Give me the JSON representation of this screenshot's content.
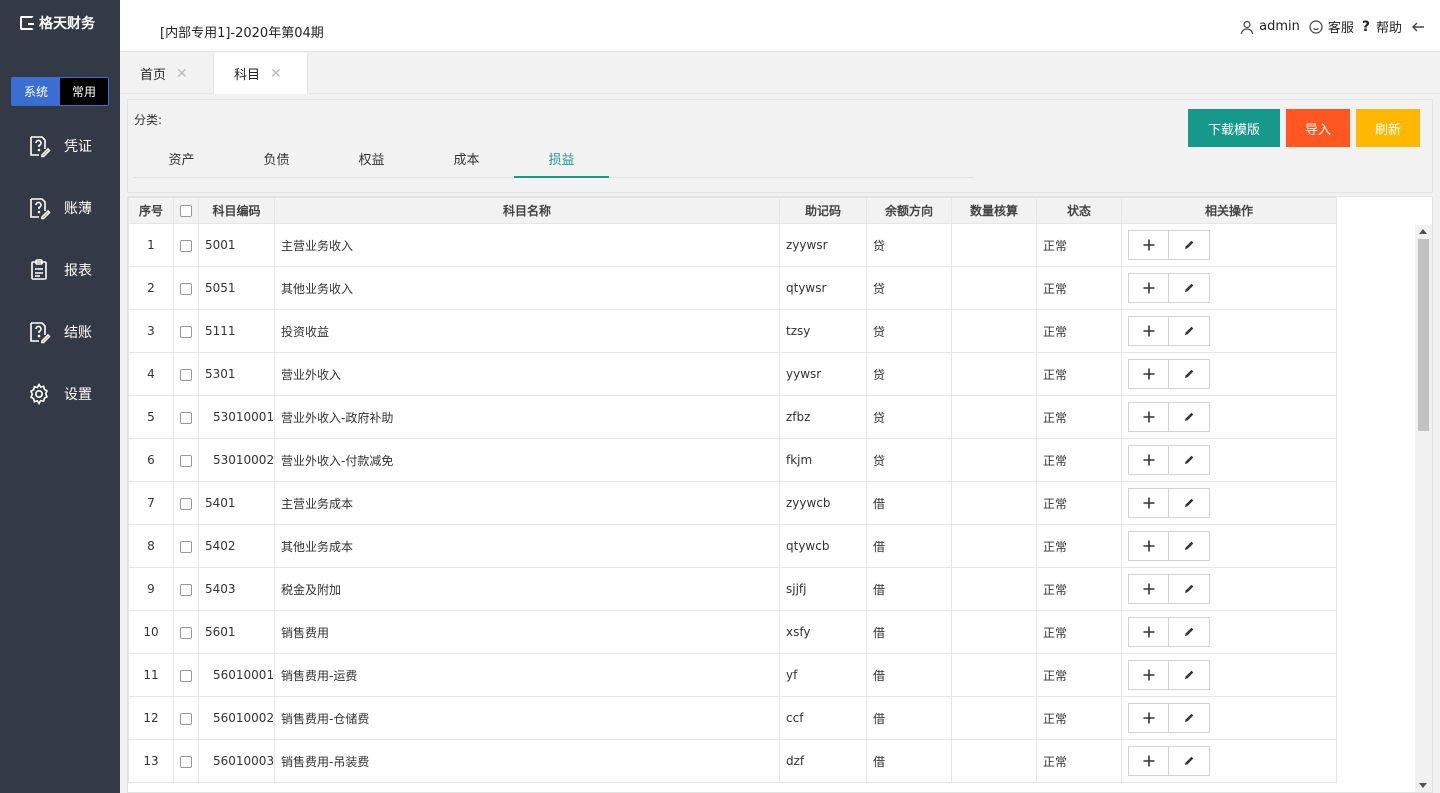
{
  "app": {
    "logo_text": "格天财务",
    "mode_switch": {
      "system": "系统",
      "common": "常用"
    }
  },
  "sidebar": {
    "items": [
      {
        "label": "凭证",
        "icon": "document-question-icon"
      },
      {
        "label": "账薄",
        "icon": "document-question-icon"
      },
      {
        "label": "报表",
        "icon": "clipboard-icon"
      },
      {
        "label": "结账",
        "icon": "document-question-icon"
      },
      {
        "label": "设置",
        "icon": "gear-icon"
      }
    ]
  },
  "header": {
    "period": "[内部专用1]-2020年第04期",
    "user": "admin",
    "service": "客服",
    "help": "帮助"
  },
  "page_tabs": [
    {
      "label": "首页"
    },
    {
      "label": "科目"
    }
  ],
  "filter": {
    "label": "分类:",
    "categories": [
      "资产",
      "负债",
      "权益",
      "成本",
      "损益"
    ],
    "active_category": "损益",
    "buttons": {
      "download": "下载模版",
      "import": "导入",
      "refresh": "刷新"
    }
  },
  "table": {
    "headers": [
      "序号",
      "",
      "科目编码",
      "科目名称",
      "助记码",
      "余额方向",
      "数量核算",
      "状态",
      "相关操作"
    ],
    "rows": [
      {
        "idx": "1",
        "code": "5001",
        "name": "主营业务收入",
        "mnemonic": "zyywsr",
        "direction": "贷",
        "qty": "",
        "status": "正常",
        "sub": false
      },
      {
        "idx": "2",
        "code": "5051",
        "name": "其他业务收入",
        "mnemonic": "qtywsr",
        "direction": "贷",
        "qty": "",
        "status": "正常",
        "sub": false
      },
      {
        "idx": "3",
        "code": "5111",
        "name": "投资收益",
        "mnemonic": "tzsy",
        "direction": "贷",
        "qty": "",
        "status": "正常",
        "sub": false
      },
      {
        "idx": "4",
        "code": "5301",
        "name": "营业外收入",
        "mnemonic": "yywsr",
        "direction": "贷",
        "qty": "",
        "status": "正常",
        "sub": false
      },
      {
        "idx": "5",
        "code": "53010001",
        "name": "营业外收入-政府补助",
        "mnemonic": "zfbz",
        "direction": "贷",
        "qty": "",
        "status": "正常",
        "sub": true
      },
      {
        "idx": "6",
        "code": "53010002",
        "name": "营业外收入-付款减免",
        "mnemonic": "fkjm",
        "direction": "贷",
        "qty": "",
        "status": "正常",
        "sub": true
      },
      {
        "idx": "7",
        "code": "5401",
        "name": "主营业务成本",
        "mnemonic": "zyywcb",
        "direction": "借",
        "qty": "",
        "status": "正常",
        "sub": false
      },
      {
        "idx": "8",
        "code": "5402",
        "name": "其他业务成本",
        "mnemonic": "qtywcb",
        "direction": "借",
        "qty": "",
        "status": "正常",
        "sub": false
      },
      {
        "idx": "9",
        "code": "5403",
        "name": "税金及附加",
        "mnemonic": "sjjfj",
        "direction": "借",
        "qty": "",
        "status": "正常",
        "sub": false
      },
      {
        "idx": "10",
        "code": "5601",
        "name": "销售费用",
        "mnemonic": "xsfy",
        "direction": "借",
        "qty": "",
        "status": "正常",
        "sub": false
      },
      {
        "idx": "11",
        "code": "56010001",
        "name": "销售费用-运费",
        "mnemonic": "yf",
        "direction": "借",
        "qty": "",
        "status": "正常",
        "sub": true
      },
      {
        "idx": "12",
        "code": "56010002",
        "name": "销售费用-仓储费",
        "mnemonic": "ccf",
        "direction": "借",
        "qty": "",
        "status": "正常",
        "sub": true
      },
      {
        "idx": "13",
        "code": "56010003",
        "name": "销售费用-吊装费",
        "mnemonic": "dzf",
        "direction": "借",
        "qty": "",
        "status": "正常",
        "sub": true
      }
    ]
  },
  "colors": {
    "sidebar_bg": "#343a45",
    "accent_green": "#16998a",
    "import_orange": "#ff5722",
    "refresh_yellow": "#ffb800",
    "switch_blue": "#3a6ed1"
  }
}
